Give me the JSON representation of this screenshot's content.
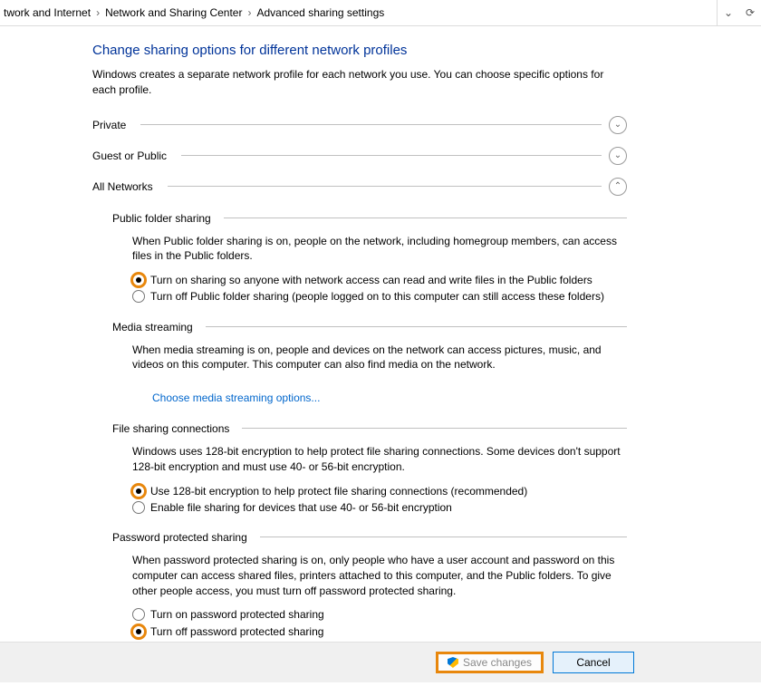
{
  "breadcrumb": {
    "first_fragment": "twork and Internet",
    "second": "Network and Sharing Center",
    "third": "Advanced sharing settings"
  },
  "page": {
    "title": "Change sharing options for different network profiles",
    "intro": "Windows creates a separate network profile for each network you use. You can choose specific options for each profile."
  },
  "profiles": {
    "private": {
      "label": "Private",
      "expanded": false
    },
    "guest": {
      "label": "Guest or Public",
      "expanded": false
    },
    "all": {
      "label": "All Networks",
      "expanded": true
    }
  },
  "all_networks": {
    "public_folder": {
      "heading": "Public folder sharing",
      "desc": "When Public folder sharing is on, people on the network, including homegroup members, can access files in the Public folders.",
      "opt_on": "Turn on sharing so anyone with network access can read and write files in the Public folders",
      "opt_off": "Turn off Public folder sharing (people logged on to this computer can still access these folders)",
      "selected": "on"
    },
    "media": {
      "heading": "Media streaming",
      "desc": "When media streaming is on, people and devices on the network can access pictures, music, and videos on this computer. This computer can also find media on the network.",
      "link": "Choose media streaming options..."
    },
    "file_enc": {
      "heading": "File sharing connections",
      "desc": "Windows uses 128-bit encryption to help protect file sharing connections. Some devices don't support 128-bit encryption and must use 40- or 56-bit encryption.",
      "opt_128": "Use 128-bit encryption to help protect file sharing connections (recommended)",
      "opt_40": "Enable file sharing for devices that use 40- or 56-bit encryption",
      "selected": "128"
    },
    "password": {
      "heading": "Password protected sharing",
      "desc": "When password protected sharing is on, only people who have a user account and password on this computer can access shared files, printers attached to this computer, and the Public folders. To give other people access, you must turn off password protected sharing.",
      "opt_on": "Turn on password protected sharing",
      "opt_off": "Turn off password protected sharing",
      "selected": "off"
    }
  },
  "footer": {
    "save": "Save changes",
    "cancel": "Cancel"
  },
  "glyphs": {
    "crumb_sep": "›",
    "chev_down": "⌄",
    "chev_up": "⌃",
    "dropdown": "⌄",
    "refresh": "⟳"
  }
}
